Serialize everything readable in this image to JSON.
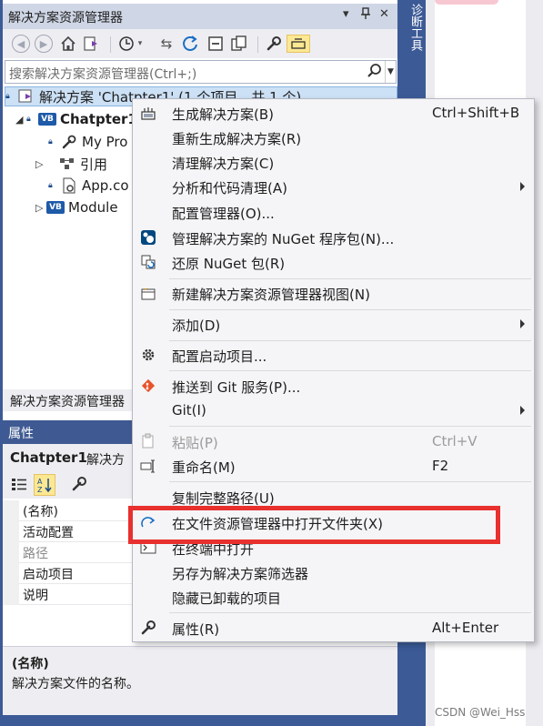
{
  "solution_explorer": {
    "title": "解决方案资源管理器",
    "title_buttons": {
      "dropdown": "▾",
      "pin": "⊥",
      "close": "✕"
    },
    "search_placeholder": "搜索解决方案资源管理器(Ctrl+;)",
    "tree": {
      "solution_label": "解决方案 'Chatpter1' (1 个项目，共 1 个)",
      "project_label": "Chatpter1",
      "my_project_label": "My Pro",
      "references_label": "引用",
      "app_config_label": "App.co",
      "module_label": "Module"
    },
    "footer_label": "解决方案资源管理器"
  },
  "side_tab": {
    "label": "诊断工具"
  },
  "properties": {
    "title": "属性",
    "object_name": "Chatpter1",
    "object_type": "解决方",
    "rows": [
      {
        "key": "(名称)"
      },
      {
        "key": "活动配置"
      },
      {
        "key": "路径"
      },
      {
        "key": "启动项目"
      },
      {
        "key": "说明"
      }
    ],
    "description_title": "(名称)",
    "description_text": "解决方案文件的名称。"
  },
  "context_menu": {
    "items": [
      {
        "label": "生成解决方案(B)",
        "shortcut": "Ctrl+Shift+B",
        "icon": "build-icon"
      },
      {
        "label": "重新生成解决方案(R)",
        "shortcut": ""
      },
      {
        "label": "清理解决方案(C)",
        "shortcut": ""
      },
      {
        "label": "分析和代码清理(A)",
        "shortcut": "",
        "submenu": true
      },
      {
        "label": "配置管理器(O)...",
        "shortcut": ""
      },
      {
        "label": "管理解决方案的 NuGet 程序包(N)...",
        "shortcut": "",
        "icon": "nuget-icon"
      },
      {
        "label": "还原 NuGet 包(R)",
        "shortcut": "",
        "icon": "restore-icon"
      },
      {
        "label": "新建解决方案资源管理器视图(N)",
        "shortcut": "",
        "icon": "new-view-icon"
      },
      {
        "label": "添加(D)",
        "shortcut": "",
        "submenu": true
      },
      {
        "label": "配置启动项目...",
        "shortcut": "",
        "icon": "gear-icon"
      },
      {
        "label": "推送到 Git 服务(P)...",
        "shortcut": "",
        "icon": "git-icon"
      },
      {
        "label": "Git(I)",
        "shortcut": "",
        "submenu": true
      },
      {
        "label": "粘贴(P)",
        "shortcut": "Ctrl+V",
        "icon": "paste-icon",
        "disabled": true
      },
      {
        "label": "重命名(M)",
        "shortcut": "F2",
        "icon": "rename-icon"
      },
      {
        "label": "复制完整路径(U)",
        "shortcut": ""
      },
      {
        "label": "在文件资源管理器中打开文件夹(X)",
        "shortcut": "",
        "icon": "redo-arrow-icon"
      },
      {
        "label": "在终端中打开",
        "shortcut": "",
        "icon": "terminal-icon"
      },
      {
        "label": "另存为解决方案筛选器",
        "shortcut": ""
      },
      {
        "label": "隐藏已卸载的项目",
        "shortcut": ""
      },
      {
        "label": "属性(R)",
        "shortcut": "Alt+Enter",
        "icon": "wrench-icon"
      }
    ]
  },
  "watermark": "CSDN @Wei_Hss",
  "colors": {
    "frame": "#3c5a96",
    "highlight_box": "#e8302e",
    "selection": "#cce1f6"
  }
}
